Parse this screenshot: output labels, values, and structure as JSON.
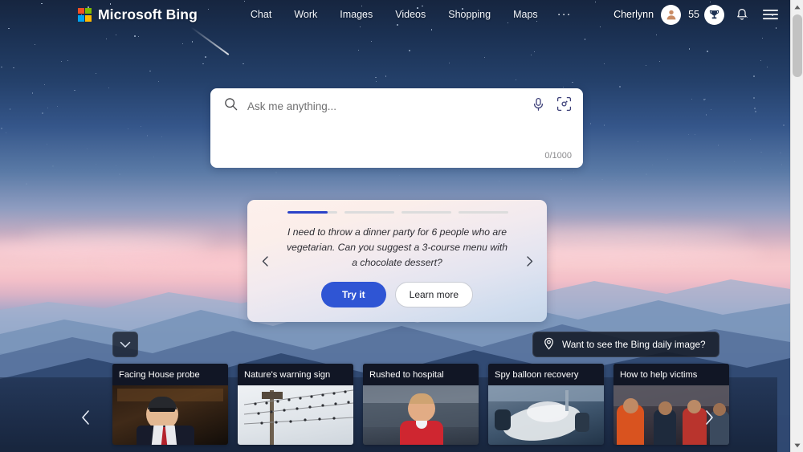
{
  "header": {
    "brand": "Microsoft Bing",
    "logo_icon": "microsoft-squares-icon",
    "logo_colors": [
      "#f25022",
      "#7fba00",
      "#00a4ef",
      "#ffb900"
    ],
    "nav": [
      {
        "label": "Chat"
      },
      {
        "label": "Work"
      },
      {
        "label": "Images"
      },
      {
        "label": "Videos"
      },
      {
        "label": "Shopping"
      },
      {
        "label": "Maps"
      }
    ],
    "more_label": "···",
    "user_name": "Cherlynn",
    "avatar_icon": "person-avatar-icon",
    "rewards_count": "55",
    "rewards_icon": "trophy-icon",
    "notifications_icon": "bell-icon",
    "menu_icon": "hamburger-menu-icon"
  },
  "search": {
    "placeholder": "Ask me anything...",
    "value": "",
    "search_icon": "search-icon",
    "mic_icon": "microphone-icon",
    "lens_icon": "visual-search-camera-icon",
    "char_count": "0/1000"
  },
  "suggestion": {
    "progress": [
      {
        "fill_percent": 80
      },
      {
        "fill_percent": 0
      },
      {
        "fill_percent": 0
      },
      {
        "fill_percent": 0
      }
    ],
    "text": "I need to throw a dinner party for 6 people who are vegetarian. Can you suggest a 3-course menu with a chocolate dessert?",
    "try_label": "Try it",
    "learn_label": "Learn more",
    "prev_icon": "chevron-left-icon",
    "next_icon": "chevron-right-icon",
    "accent_color": "#2f55d4"
  },
  "daily_image": {
    "label": "Want to see the Bing daily image?",
    "icon": "location-pin-icon"
  },
  "collapse": {
    "icon": "chevron-down-icon"
  },
  "carousel": {
    "prev_icon": "chevron-left-icon",
    "next_icon": "chevron-right-icon",
    "cards": [
      {
        "title": "Facing House probe"
      },
      {
        "title": "Nature's warning sign"
      },
      {
        "title": "Rushed to hospital"
      },
      {
        "title": "Spy balloon recovery"
      },
      {
        "title": "How to help victims"
      }
    ]
  },
  "scrollbar": {
    "up_icon": "scroll-up-arrow-icon",
    "down_icon": "scroll-down-arrow-icon"
  }
}
